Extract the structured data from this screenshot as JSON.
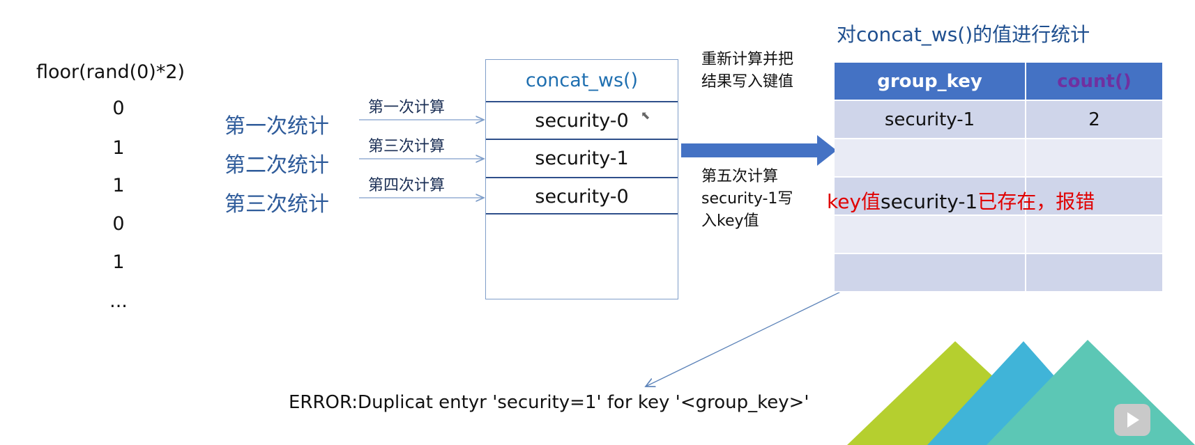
{
  "formula": "floor(rand(0)*2)",
  "sequence": [
    "0",
    "1",
    "1",
    "0",
    "1",
    "..."
  ],
  "passes": [
    "第一次统计",
    "第二次统计",
    "第三次统计"
  ],
  "calcs": [
    "第一次计算",
    "第三次计算",
    "第四次计算"
  ],
  "concat": {
    "title": "concat_ws()",
    "rows": [
      "security-0",
      "security-1",
      "security-0"
    ]
  },
  "notes": {
    "top": "重新计算并把结果写入键值",
    "bottom": "第五次计算security-1写入key值"
  },
  "stats": {
    "title": "对concat_ws()的值进行统计",
    "headers": [
      "group_key",
      "count()"
    ],
    "rows": [
      [
        "security-1",
        "2"
      ],
      [
        "",
        ""
      ],
      [
        "",
        ""
      ],
      [
        "",
        ""
      ],
      [
        "",
        ""
      ]
    ]
  },
  "warning": {
    "part1": "key值",
    "part2": "security-1",
    "part3": "已存在，报错"
  },
  "error": "ERROR:Duplicat entyr 'security=1' for key '<group_key>'",
  "colors": {
    "blue_arrow": "#4472c4",
    "header": "#4472c4",
    "warn": "#e00000",
    "triangle_green": "#b5cf2f",
    "triangle_blue": "#40b4d8",
    "triangle_teal": "#5cc7b5"
  }
}
